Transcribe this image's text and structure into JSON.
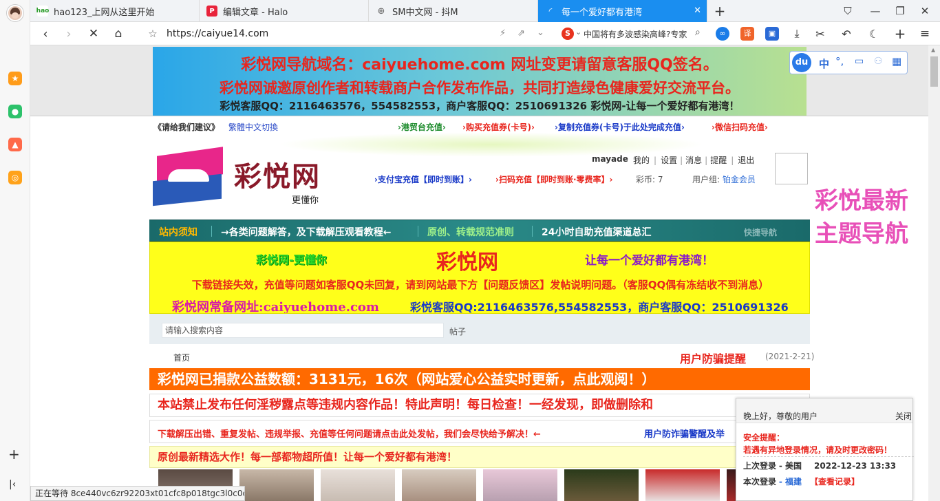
{
  "tabs": [
    {
      "title": "hao123_上网从这里开始",
      "icon": "hao123-icon"
    },
    {
      "title": "编辑文章 - Halo",
      "icon": "halo-icon"
    },
    {
      "title": "SM中文网 - 抖M",
      "icon": "globe-icon"
    },
    {
      "title": "每一个爱好都有港湾",
      "icon": "loading-icon"
    }
  ],
  "address": {
    "url": "https://caiyue14.com",
    "search_text": "中国将有多波感染高峰?专家"
  },
  "top_banner": {
    "line1": "彩悦网导航域名：caiyuehome.com 网址变更请留意客服QQ签名。",
    "line2": "彩悦网诚邀原创作者和转载商户合作发布作品，共同打造绿色健康爱好交流平台。",
    "line3": "彩悦客服QQ：2116463576，554582553，商户客服QQ：2510691326  彩悦网-让每一个爱好都有港湾！"
  },
  "du_toolbar": {
    "logo": "du",
    "lang": "中"
  },
  "top_links": {
    "suggest": "《请给我们建议》",
    "trad": "繁體中文切換",
    "links": [
      "港贸台充值",
      "购买充值券(卡号)",
      "复制充值券(卡号)于此处完成充值",
      "微信扫码充值"
    ]
  },
  "logo": {
    "name": "彩悦网",
    "tagline": "更懂你"
  },
  "user": {
    "name": "mayade",
    "menu": [
      "我的",
      "设置",
      "消息",
      "提醒",
      "退出"
    ],
    "alipay": "支付宝充值【即时到账】",
    "scan": "扫码充值【即时到账·零费率】",
    "coins_label": "彩币:",
    "coins": "7",
    "group_label": "用户组:",
    "group": "铂金会员"
  },
  "theme_nav": {
    "line1": "彩悦最新",
    "line2": "主题导航"
  },
  "nav": {
    "items": [
      "站内须知",
      "→各类问题解答，及下载解压观看教程←",
      "原创、转载规范准则",
      "24小时自助充值渠道总汇"
    ],
    "quick": "快捷导航"
  },
  "yellow_banner": {
    "left": "彩悦网-更懂你",
    "center": "彩悦网",
    "right": "让每一个爱好都有港湾！",
    "notice": "下载链接失效，充值等问题如客服QQ未回复，请到网站最下方【问题反馈区】发帖说明问题。（客服QQ偶有冻结收不到消息）",
    "addr": "彩悦网常备网址:caiyuehome.com",
    "qq": "彩悦客服QQ:2116463576,554582553，商户客服QQ：2510691326"
  },
  "search": {
    "placeholder": "请输入搜索内容",
    "type": "帖子"
  },
  "breadcrumb": {
    "home": "首页",
    "alert": "用户防骗提醒",
    "date": "(2021-2-21)"
  },
  "donate": "彩悦网已捐款公益数额：3131元，16次（网站爱心公益实时更新，点此观阅！）",
  "forbid": "本站禁止发布任何淫秽露点等违规内容作品！特此声明！每日检查！一经发现，即做删除和",
  "report": {
    "text": "下载解压出错、重复发帖、违规举报、充值等任何问题请点击此处发帖，我们会尽快给予解决！←",
    "link": "用户防诈骗警醒及举"
  },
  "original": "原创最新精选大作！每一部都物超所值！让每一个爱好都有港湾！",
  "popup": {
    "greet": "晚上好，尊敬的用户",
    "close": "关闭",
    "warn_title": "安全提醒：",
    "warn_text": "若遇有异地登录情况，请及时更改密码！",
    "last_label": "上次登录",
    "last_loc": "- 美国",
    "last_time": "2022-12-23 13:33",
    "this_label": "本次登录",
    "this_loc": "- 福建",
    "history": "【查看记录】"
  },
  "status": "正在等待 8ce440vc6zr92203xt01cfc8p018tgc3l0c0c...",
  "colors": {
    "nav_teal": "#1a7d7a",
    "donate_orange": "#ff6a00",
    "banner_yellow": "#ffff1a",
    "active_tab": "#1a8ef0"
  }
}
